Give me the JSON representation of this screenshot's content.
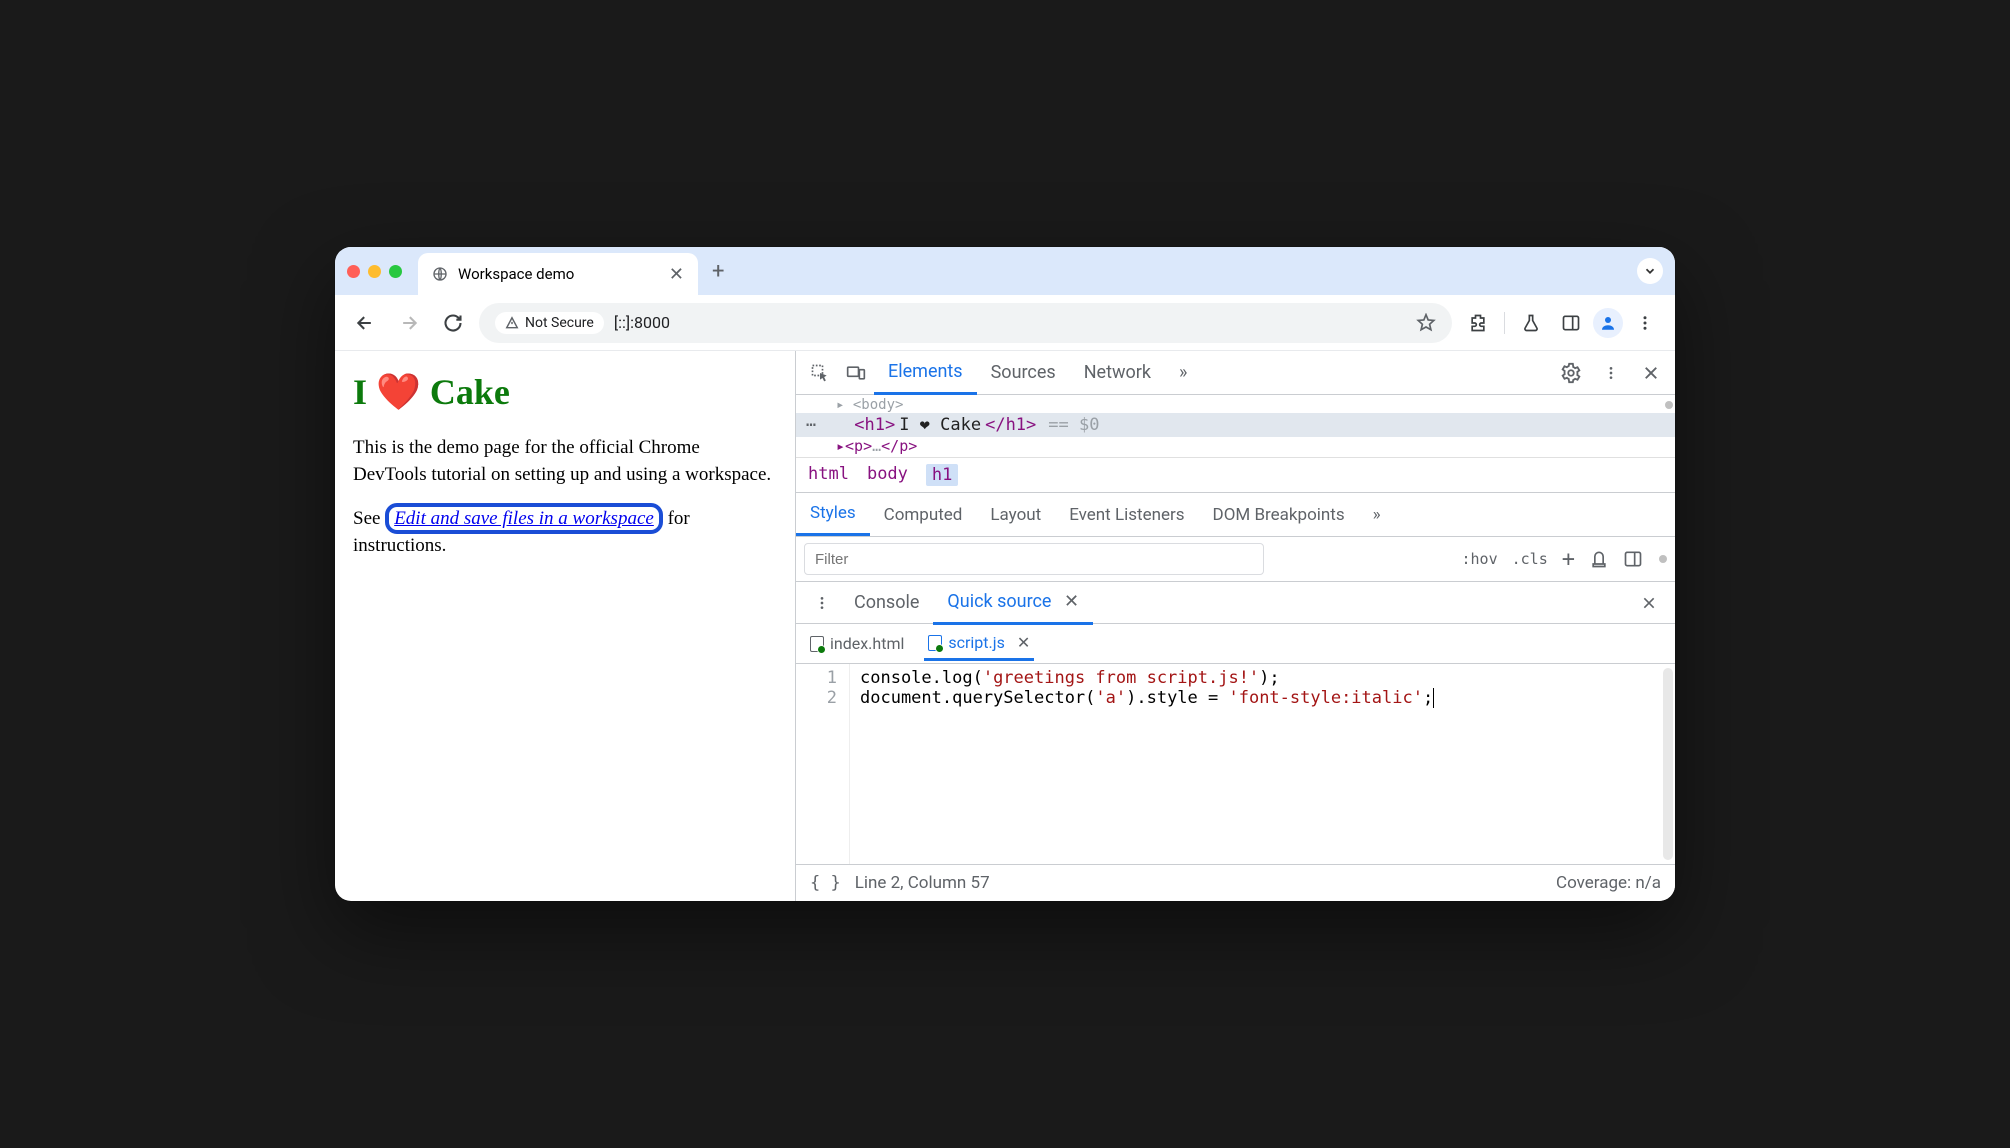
{
  "browser": {
    "tab_title": "Workspace demo",
    "security_label": "Not Secure",
    "url": "[::]:8000"
  },
  "page": {
    "heading": "I ❤️ Cake",
    "intro": "This is the demo page for the official Chrome DevTools tutorial on setting up and using a workspace.",
    "see_prefix": "See ",
    "link_text": "Edit and save files in a workspace",
    "see_suffix": " for instructions."
  },
  "devtools": {
    "tabs": {
      "elements": "Elements",
      "sources": "Sources",
      "network": "Network",
      "more": "»"
    },
    "dom": {
      "body_open_fragment": "<body>",
      "line_open": "<h1>",
      "line_text": "I ❤ Cake",
      "line_close": "</h1>",
      "annotation": "== $0",
      "next_fragment": "▸<p>…</p>"
    },
    "crumbs": [
      "html",
      "body",
      "h1"
    ],
    "styles_tabs": {
      "styles": "Styles",
      "computed": "Computed",
      "layout": "Layout",
      "listeners": "Event Listeners",
      "dom_bp": "DOM Breakpoints",
      "more": "»"
    },
    "filter": {
      "placeholder": "Filter",
      "hov": ":hov",
      "cls": ".cls"
    },
    "drawer": {
      "console": "Console",
      "quick_source": "Quick source"
    },
    "files": {
      "index": "index.html",
      "script": "script.js"
    },
    "code": {
      "l1": "console.log('greetings from script.js!');",
      "l2": "document.querySelector('a').style = 'font-style:italic';"
    },
    "status": {
      "pos": "Line 2, Column 57",
      "coverage": "Coverage: n/a"
    }
  }
}
